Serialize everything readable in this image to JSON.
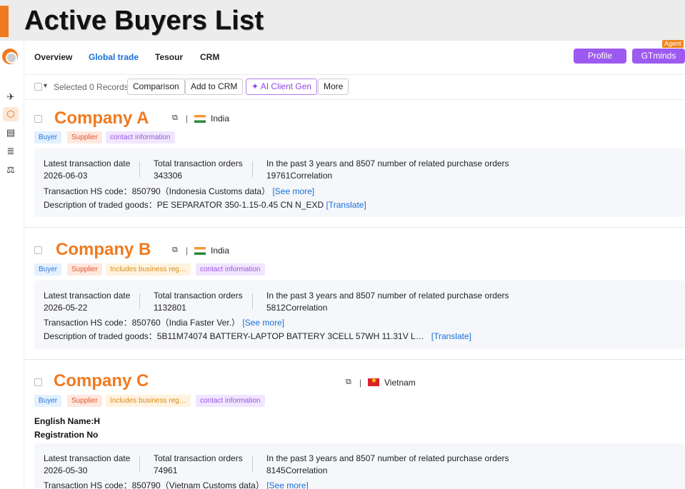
{
  "banner": {
    "title": "Active Buyers List"
  },
  "nav": {
    "items": [
      "Overview",
      "Global trade",
      "Tesour",
      "CRM"
    ],
    "active": "Global trade",
    "profile_label": "Profile",
    "gtminds_label": "GTminds",
    "agent_badge": "Agent"
  },
  "rail": {
    "icons": [
      "rocket-icon",
      "cube-icon",
      "building-icon",
      "chart-icon",
      "scale-icon"
    ]
  },
  "toolbar": {
    "selected_text": "Selected 0 Records",
    "comparison_label": "Comparison",
    "add_crm_label": "Add to CRM",
    "ai_label": "AI Client Gen",
    "more_label": "More"
  },
  "labels": {
    "latest_date": "Latest transaction date",
    "total_orders": "Total transaction orders",
    "past3": "In the past 3 years and 8507 number of related purchase orders",
    "see_more": "[See more]",
    "translate": "[Translate]",
    "hs_prefix": "Transaction HS code：",
    "desc_prefix": "Description of traded goods："
  },
  "companies": [
    {
      "name": "Company A",
      "country": "India",
      "tags": [
        "Buyer",
        "Supplier",
        "contact information"
      ],
      "latest_date": "2026-06-03",
      "total_orders": "343306",
      "correlation": "19761Correlation",
      "hs_code": "850790（Indonesia Customs data）",
      "description": "PE SEPARATOR 350-1.15-0.45 CN N_EXD"
    },
    {
      "name": "Company B",
      "country": "India",
      "tags": [
        "Buyer",
        "Supplier",
        "Includes business reg…",
        "contact information"
      ],
      "latest_date": "2026-05-22",
      "total_orders": "1132801",
      "correlation": "5812Correlation",
      "hs_code": "850760（India Faster Ver.）",
      "description": "5B11M74074 BATTERY-LAPTOP BATTERY 3CELL 57WH 11.31V L…"
    },
    {
      "name": "Company C",
      "country": "Vietnam",
      "tags": [
        "Buyer",
        "Supplier",
        "Includes business reg…",
        "contact information"
      ],
      "english_name": "English Name:H",
      "registration_no": "Registration No",
      "latest_date": "2026-05-30",
      "total_orders": "74961",
      "correlation": "8145Correlation",
      "hs_code": "850790（Vietnam Customs data）"
    }
  ]
}
